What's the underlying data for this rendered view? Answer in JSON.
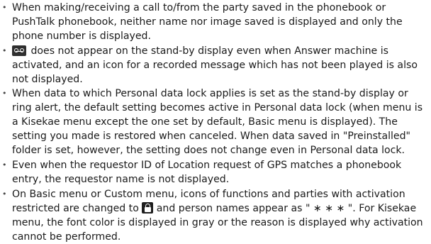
{
  "items": [
    {
      "text": "When making/receiving a call to/from the party saved in the phonebook or PushTalk phonebook, neither name nor image saved is displayed and only the phone number is displayed."
    },
    {
      "icon": "answer-machine-icon",
      "text": "does not appear on the stand-by display even when Answer machine is activated, and an icon for a recorded message which has not been played is also not displayed."
    },
    {
      "text": "When data to which Personal data lock applies is set as the stand-by display or ring alert, the default setting becomes active in Personal data lock (when menu is a Kisekae menu except the one set by default, Basic menu is displayed). The setting you made is restored when canceled. When data saved in \"Preinstalled\" folder is set, however, the setting does not change even in Personal data lock."
    },
    {
      "text": "Even when the requestor ID of Location request of GPS matches a phonebook entry, the requestor name is not displayed."
    },
    {
      "text_before": "On Basic menu or Custom menu, icons of functions and parties with activation restricted are changed to",
      "icon": "lock-icon",
      "text_after": "and person names appear as \" ∗ ∗ ∗ \". For Kisekae menu, the font color is displayed in gray or the reason is displayed why activation cannot be performed."
    }
  ]
}
